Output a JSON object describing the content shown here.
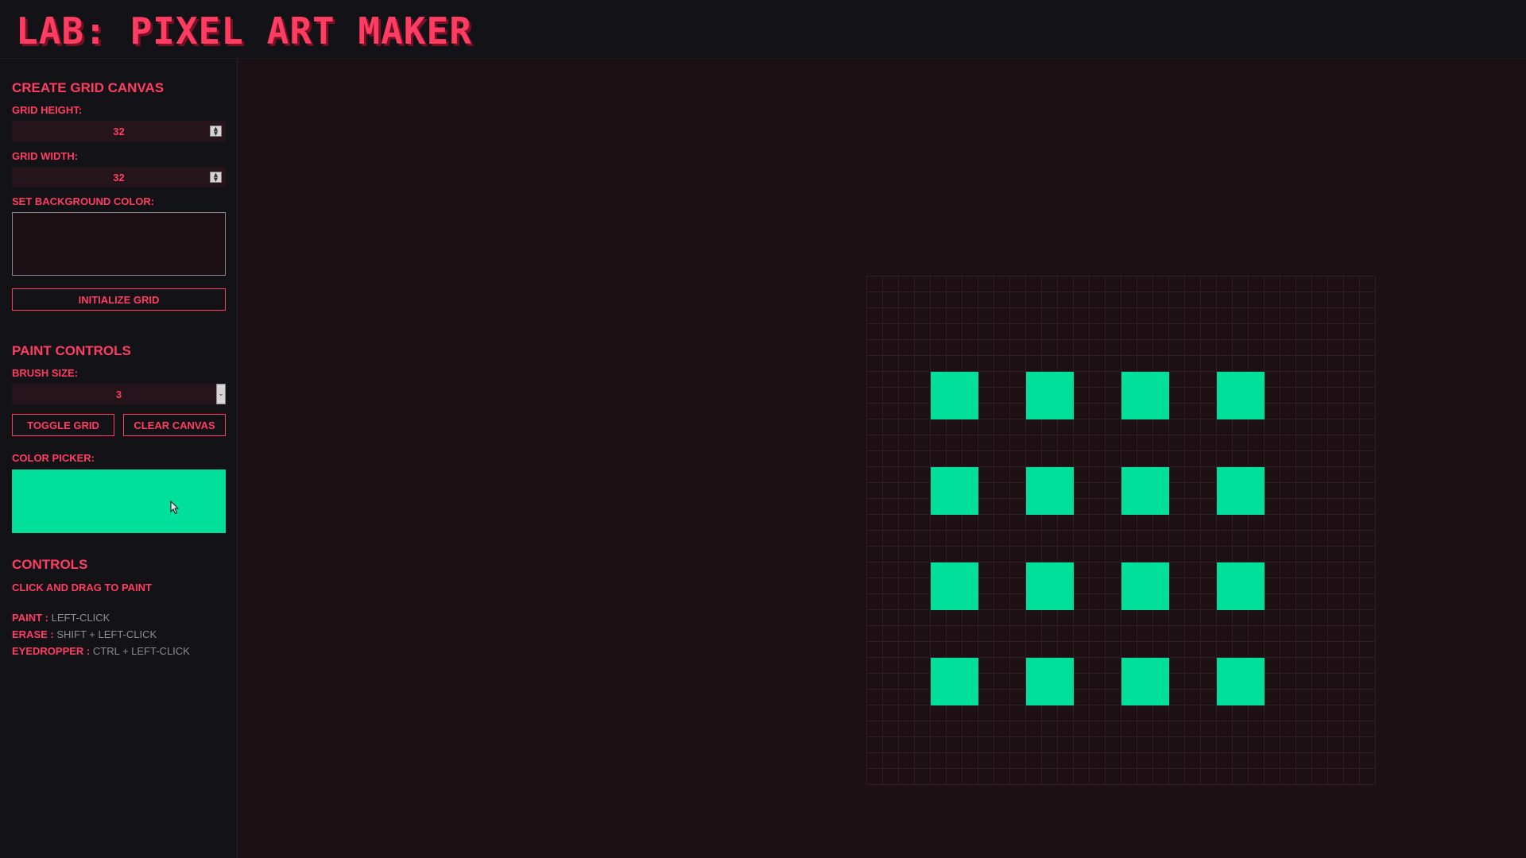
{
  "app": {
    "title": "LAB: PIXEL ART MAKER"
  },
  "create_grid": {
    "heading": "CREATE GRID CANVAS",
    "height_label": "GRID HEIGHT:",
    "height_value": "32",
    "width_label": "GRID WIDTH:",
    "width_value": "32",
    "bg_label": "SET BACKGROUND COLOR:",
    "bg_color": "#1c1014",
    "init_button": "INITIALIZE GRID"
  },
  "paint_controls": {
    "heading": "PAINT CONTROLS",
    "brush_label": "BRUSH SIZE:",
    "brush_value": "3",
    "toggle_grid_button": "TOGGLE GRID",
    "clear_canvas_button": "CLEAR CANVAS",
    "color_label": "COLOR PICKER:",
    "color_value": "#00e09a"
  },
  "controls_help": {
    "heading": "CONTROLS",
    "intro": "CLICK AND DRAG TO PAINT",
    "items": [
      {
        "key": "PAINT :",
        "value": "LEFT-CLICK"
      },
      {
        "key": "ERASE :",
        "value": "SHIFT + LEFT-CLICK"
      },
      {
        "key": "EYEDROPPER :",
        "value": "CTRL + LEFT-CLICK"
      }
    ]
  },
  "canvas": {
    "rows": 32,
    "cols": 32,
    "grid_visible": true,
    "background_color": "#1c1014",
    "grid_line_color": "#321d24",
    "paint_color": "#00e09a",
    "painted_blocks": {
      "block_size": 3,
      "top_left_rows": [
        6,
        12,
        18,
        24
      ],
      "top_left_cols": [
        4,
        10,
        16,
        22
      ]
    }
  },
  "theme": {
    "accent": "#ff3d63",
    "panel_bg": "#131317",
    "muted_text": "#8f8a8c"
  }
}
